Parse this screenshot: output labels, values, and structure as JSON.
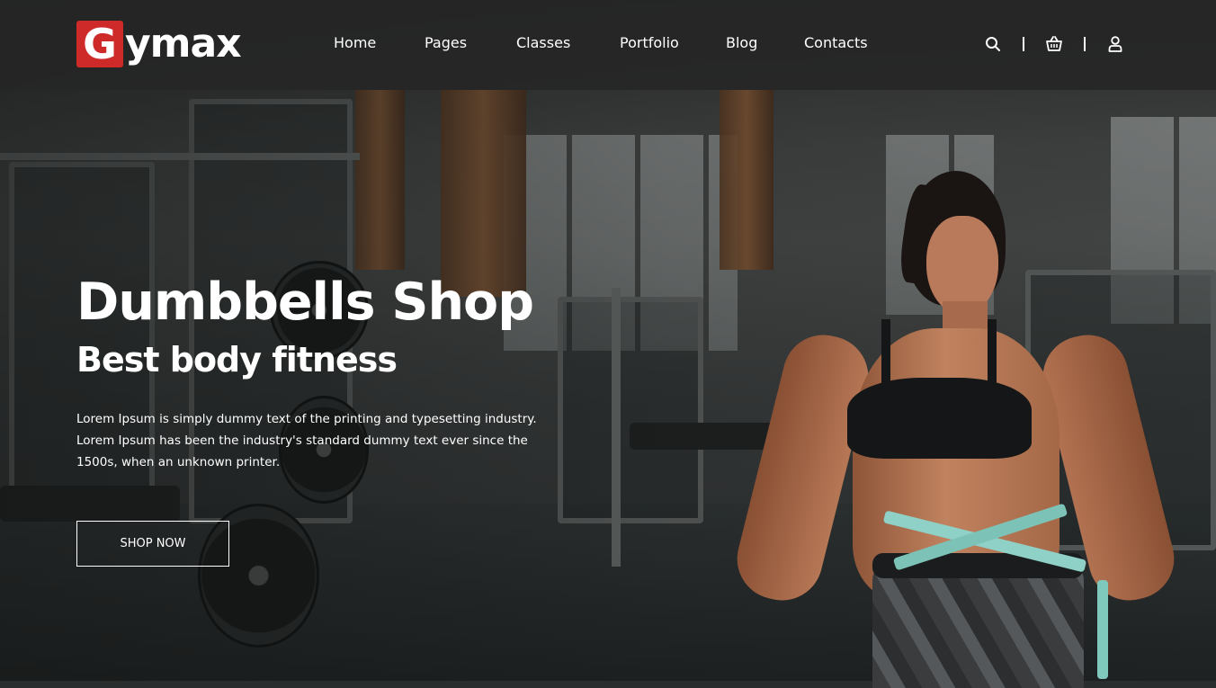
{
  "brand": {
    "logo_letter": "G",
    "logo_text": "ymax",
    "accent_color": "#cf2a2a"
  },
  "nav": {
    "items": [
      {
        "label": "Home"
      },
      {
        "label": "Pages"
      },
      {
        "label": "Classes"
      },
      {
        "label": "Portfolio"
      },
      {
        "label": "Blog"
      },
      {
        "label": "Contacts"
      }
    ]
  },
  "tools": {
    "icons": [
      "search-icon",
      "cart-icon",
      "user-icon"
    ]
  },
  "hero": {
    "title": "Dumbbells Shop",
    "subtitle": "Best body fitness",
    "text": "Lorem Ipsum is simply dummy text of the printing and typesetting industry. Lorem Ipsum has been the industry's standard dummy text ever since the 1500s, when an unknown printer.",
    "button_label": "SHOP NOW"
  }
}
